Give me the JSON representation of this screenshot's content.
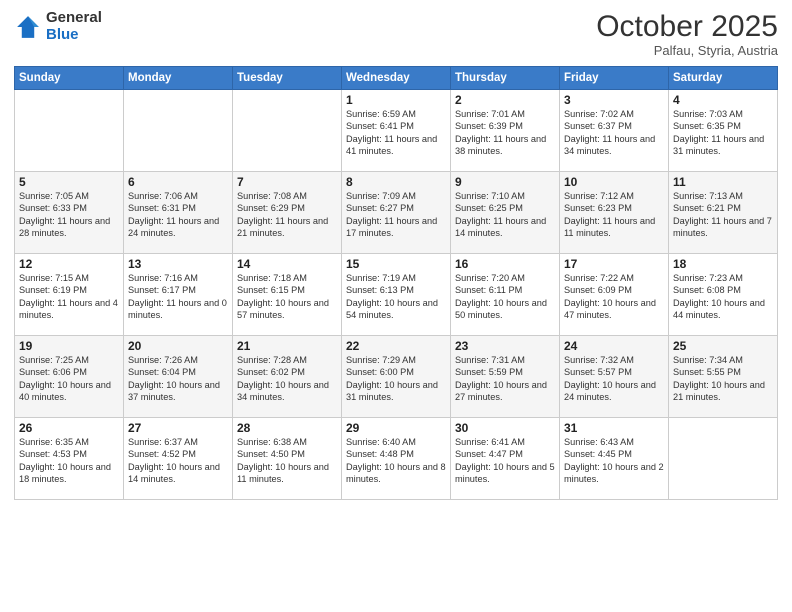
{
  "header": {
    "logo_general": "General",
    "logo_blue": "Blue",
    "month_title": "October 2025",
    "subtitle": "Palfau, Styria, Austria"
  },
  "days_of_week": [
    "Sunday",
    "Monday",
    "Tuesday",
    "Wednesday",
    "Thursday",
    "Friday",
    "Saturday"
  ],
  "weeks": [
    [
      {
        "day": "",
        "info": ""
      },
      {
        "day": "",
        "info": ""
      },
      {
        "day": "",
        "info": ""
      },
      {
        "day": "1",
        "info": "Sunrise: 6:59 AM\nSunset: 6:41 PM\nDaylight: 11 hours and 41 minutes."
      },
      {
        "day": "2",
        "info": "Sunrise: 7:01 AM\nSunset: 6:39 PM\nDaylight: 11 hours and 38 minutes."
      },
      {
        "day": "3",
        "info": "Sunrise: 7:02 AM\nSunset: 6:37 PM\nDaylight: 11 hours and 34 minutes."
      },
      {
        "day": "4",
        "info": "Sunrise: 7:03 AM\nSunset: 6:35 PM\nDaylight: 11 hours and 31 minutes."
      }
    ],
    [
      {
        "day": "5",
        "info": "Sunrise: 7:05 AM\nSunset: 6:33 PM\nDaylight: 11 hours and 28 minutes."
      },
      {
        "day": "6",
        "info": "Sunrise: 7:06 AM\nSunset: 6:31 PM\nDaylight: 11 hours and 24 minutes."
      },
      {
        "day": "7",
        "info": "Sunrise: 7:08 AM\nSunset: 6:29 PM\nDaylight: 11 hours and 21 minutes."
      },
      {
        "day": "8",
        "info": "Sunrise: 7:09 AM\nSunset: 6:27 PM\nDaylight: 11 hours and 17 minutes."
      },
      {
        "day": "9",
        "info": "Sunrise: 7:10 AM\nSunset: 6:25 PM\nDaylight: 11 hours and 14 minutes."
      },
      {
        "day": "10",
        "info": "Sunrise: 7:12 AM\nSunset: 6:23 PM\nDaylight: 11 hours and 11 minutes."
      },
      {
        "day": "11",
        "info": "Sunrise: 7:13 AM\nSunset: 6:21 PM\nDaylight: 11 hours and 7 minutes."
      }
    ],
    [
      {
        "day": "12",
        "info": "Sunrise: 7:15 AM\nSunset: 6:19 PM\nDaylight: 11 hours and 4 minutes."
      },
      {
        "day": "13",
        "info": "Sunrise: 7:16 AM\nSunset: 6:17 PM\nDaylight: 11 hours and 0 minutes."
      },
      {
        "day": "14",
        "info": "Sunrise: 7:18 AM\nSunset: 6:15 PM\nDaylight: 10 hours and 57 minutes."
      },
      {
        "day": "15",
        "info": "Sunrise: 7:19 AM\nSunset: 6:13 PM\nDaylight: 10 hours and 54 minutes."
      },
      {
        "day": "16",
        "info": "Sunrise: 7:20 AM\nSunset: 6:11 PM\nDaylight: 10 hours and 50 minutes."
      },
      {
        "day": "17",
        "info": "Sunrise: 7:22 AM\nSunset: 6:09 PM\nDaylight: 10 hours and 47 minutes."
      },
      {
        "day": "18",
        "info": "Sunrise: 7:23 AM\nSunset: 6:08 PM\nDaylight: 10 hours and 44 minutes."
      }
    ],
    [
      {
        "day": "19",
        "info": "Sunrise: 7:25 AM\nSunset: 6:06 PM\nDaylight: 10 hours and 40 minutes."
      },
      {
        "day": "20",
        "info": "Sunrise: 7:26 AM\nSunset: 6:04 PM\nDaylight: 10 hours and 37 minutes."
      },
      {
        "day": "21",
        "info": "Sunrise: 7:28 AM\nSunset: 6:02 PM\nDaylight: 10 hours and 34 minutes."
      },
      {
        "day": "22",
        "info": "Sunrise: 7:29 AM\nSunset: 6:00 PM\nDaylight: 10 hours and 31 minutes."
      },
      {
        "day": "23",
        "info": "Sunrise: 7:31 AM\nSunset: 5:59 PM\nDaylight: 10 hours and 27 minutes."
      },
      {
        "day": "24",
        "info": "Sunrise: 7:32 AM\nSunset: 5:57 PM\nDaylight: 10 hours and 24 minutes."
      },
      {
        "day": "25",
        "info": "Sunrise: 7:34 AM\nSunset: 5:55 PM\nDaylight: 10 hours and 21 minutes."
      }
    ],
    [
      {
        "day": "26",
        "info": "Sunrise: 6:35 AM\nSunset: 4:53 PM\nDaylight: 10 hours and 18 minutes."
      },
      {
        "day": "27",
        "info": "Sunrise: 6:37 AM\nSunset: 4:52 PM\nDaylight: 10 hours and 14 minutes."
      },
      {
        "day": "28",
        "info": "Sunrise: 6:38 AM\nSunset: 4:50 PM\nDaylight: 10 hours and 11 minutes."
      },
      {
        "day": "29",
        "info": "Sunrise: 6:40 AM\nSunset: 4:48 PM\nDaylight: 10 hours and 8 minutes."
      },
      {
        "day": "30",
        "info": "Sunrise: 6:41 AM\nSunset: 4:47 PM\nDaylight: 10 hours and 5 minutes."
      },
      {
        "day": "31",
        "info": "Sunrise: 6:43 AM\nSunset: 4:45 PM\nDaylight: 10 hours and 2 minutes."
      },
      {
        "day": "",
        "info": ""
      }
    ]
  ]
}
